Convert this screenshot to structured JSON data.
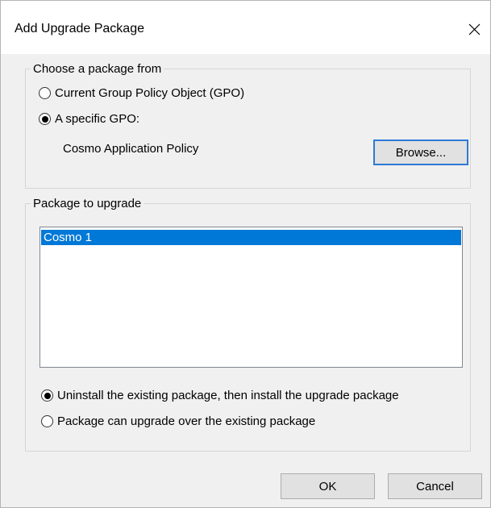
{
  "window": {
    "title": "Add Upgrade Package",
    "close_glyph": "close-icon"
  },
  "source_group": {
    "legend": "Choose a package from",
    "options": [
      {
        "label": "Current Group Policy Object (GPO)",
        "checked": false
      },
      {
        "label": "A specific GPO:",
        "checked": true
      }
    ],
    "selected_gpo": "Cosmo Application Policy",
    "browse_label": "Browse..."
  },
  "upgrade_group": {
    "legend": "Package to upgrade",
    "packages": [
      {
        "name": "Cosmo 1",
        "selected": true
      }
    ],
    "options": [
      {
        "label": "Uninstall the existing package, then install the upgrade package",
        "checked": true
      },
      {
        "label": "Package can upgrade over the existing package",
        "checked": false
      }
    ]
  },
  "footer": {
    "ok_label": "OK",
    "cancel_label": "Cancel"
  },
  "colors": {
    "selection": "#0078d7",
    "focus_border": "#2d7ad6",
    "dialog_bg": "#f0f0f0"
  }
}
